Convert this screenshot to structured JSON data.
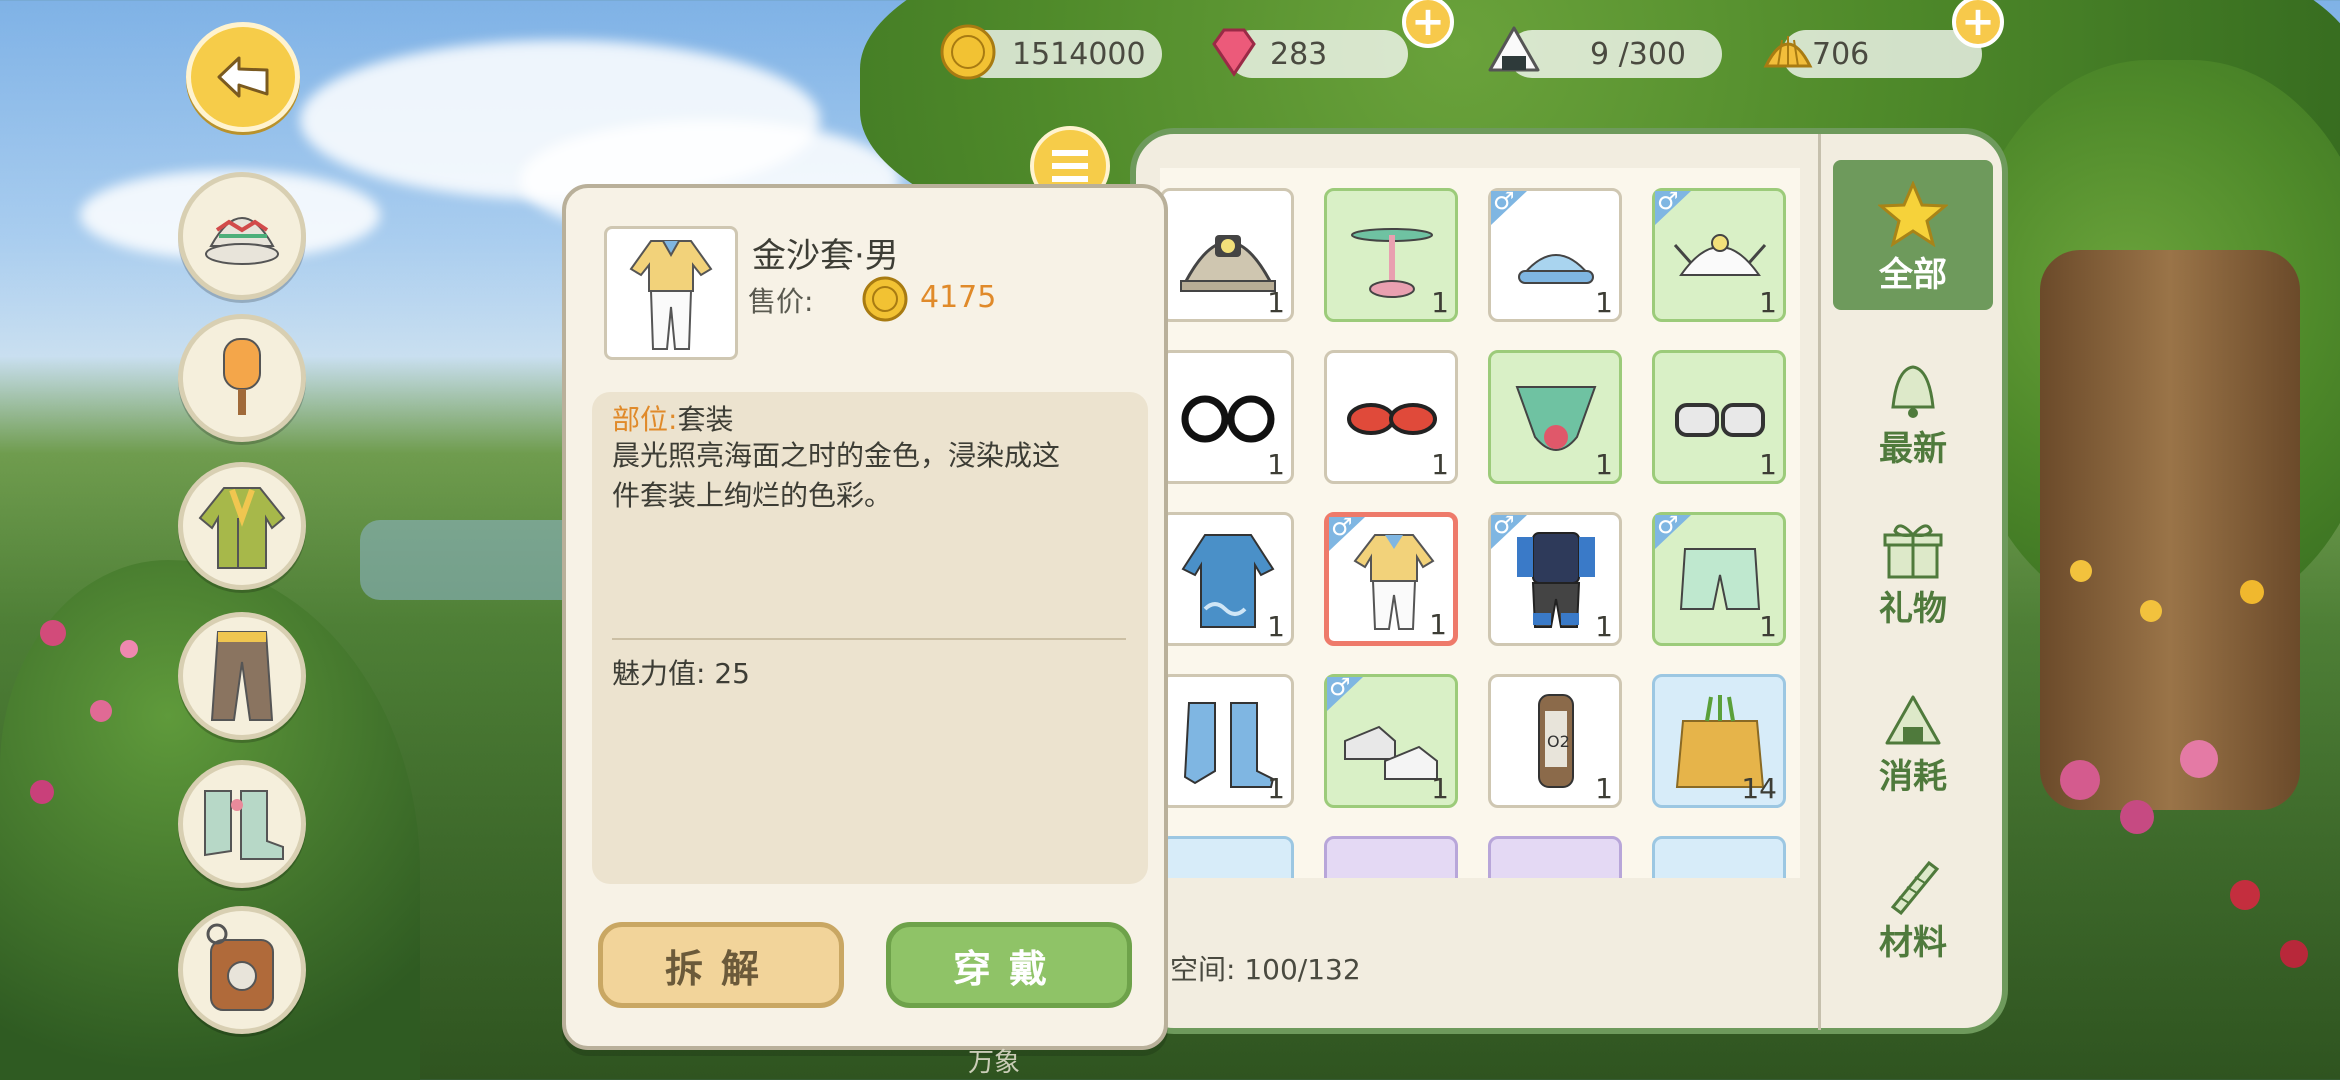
{
  "currency": {
    "gold": "1514000",
    "gems": "283",
    "stamina": "9 /300",
    "shells": "706",
    "plus_symbol": "+"
  },
  "left_categories": [
    "hat-icon",
    "mask-icon",
    "jacket-icon",
    "pants-icon",
    "boots-icon",
    "backpack-icon"
  ],
  "detail": {
    "item_name": "金沙套·男",
    "price_label": "售价:",
    "price_value": "4175",
    "slot_label": "部位:",
    "slot_value": "套装",
    "description": "晨光照亮海面之时的金色，浸染成这件套装上绚烂的色彩。",
    "charm_label": "魅力值:",
    "charm_value": "25",
    "dismantle_label": "拆解",
    "wear_label": "穿戴"
  },
  "inventory": {
    "space_label": "空间:",
    "space_value": "100/132",
    "items": [
      {
        "name": "miner-helmet",
        "count": "1",
        "bg": "white",
        "male": false
      },
      {
        "name": "propeller-hat",
        "count": "1",
        "bg": "green",
        "male": false
      },
      {
        "name": "visor-cap",
        "count": "1",
        "bg": "white",
        "male": true
      },
      {
        "name": "feather-cap",
        "count": "1",
        "bg": "green",
        "male": true
      },
      {
        "name": "round-glasses",
        "count": "1",
        "bg": "white",
        "male": false
      },
      {
        "name": "red-sunglasses",
        "count": "1",
        "bg": "white",
        "male": false
      },
      {
        "name": "green-mask",
        "count": "1",
        "bg": "green",
        "male": false
      },
      {
        "name": "goggles",
        "count": "1",
        "bg": "green",
        "male": false
      },
      {
        "name": "wave-coat",
        "count": "1",
        "bg": "white",
        "male": false
      },
      {
        "name": "golden-suit",
        "count": "1",
        "bg": "white",
        "male": true
      },
      {
        "name": "diver-suit",
        "count": "1",
        "bg": "white",
        "male": true
      },
      {
        "name": "green-shorts",
        "count": "1",
        "bg": "green",
        "male": true
      },
      {
        "name": "blue-rain-boots",
        "count": "1",
        "bg": "white",
        "male": false
      },
      {
        "name": "white-sneakers",
        "count": "1",
        "bg": "green",
        "male": true
      },
      {
        "name": "oxygen-tank",
        "count": "1",
        "bg": "white",
        "male": false
      },
      {
        "name": "seed-bag",
        "count": "14",
        "bg": "blue",
        "male": false
      }
    ],
    "partial_row": [
      "blue",
      "purple",
      "purple",
      "blue"
    ]
  },
  "tabs": [
    {
      "label": "全部",
      "icon": "star-icon"
    },
    {
      "label": "最新",
      "icon": "bell-icon"
    },
    {
      "label": "礼物",
      "icon": "gift-icon"
    },
    {
      "label": "消耗",
      "icon": "riceball-icon"
    },
    {
      "label": "材料",
      "icon": "material-icon"
    }
  ],
  "watermark_text": "万象",
  "colors": {
    "accent_green": "#6e9a5c",
    "gold": "#f6cc49",
    "price": "#e08a2a",
    "selected": "#ee7a6a"
  }
}
